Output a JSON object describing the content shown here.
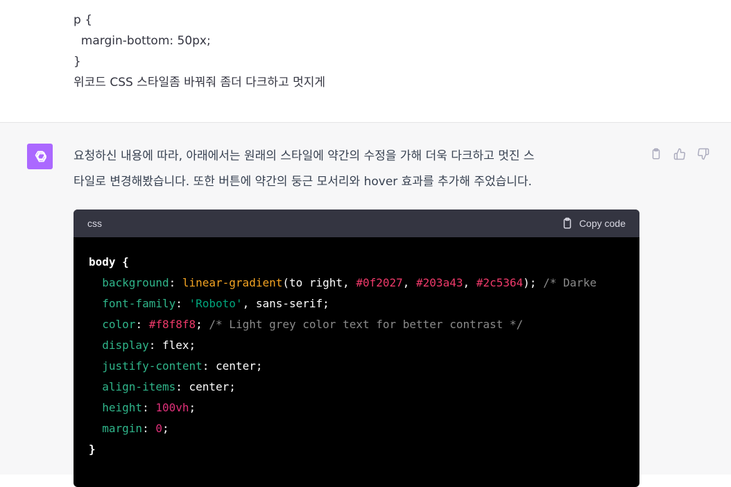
{
  "user_message": {
    "lines": [
      "p {",
      "  margin-bottom: 50px;",
      "}",
      "위코드 CSS 스타일좀 바꿔줘 좀더 다크하고 멋지게"
    ]
  },
  "assistant_message": {
    "lines": [
      "요청하신 내용에 따라, 아래에서는 원래의 스타일에 약간의 수정을 가해 더욱 다크하고 멋진 스",
      "타일로 변경해봤습니다. 또한 버튼에 약간의 둥근 모서리와 hover 효과를 추가해 주었습니다."
    ]
  },
  "code_block": {
    "language": "css",
    "copy_label": "Copy code",
    "selector": "body",
    "open_brace": " {",
    "close_brace": "}",
    "declarations": [
      {
        "prop": "background",
        "value_parts": [
          {
            "t": "fn",
            "v": "linear-gradient"
          },
          {
            "t": "plain",
            "v": "(to right, "
          },
          {
            "t": "hex",
            "v": "#0f2027"
          },
          {
            "t": "plain",
            "v": ", "
          },
          {
            "t": "hex",
            "v": "#203a43"
          },
          {
            "t": "plain",
            "v": ", "
          },
          {
            "t": "hex",
            "v": "#2c5364"
          },
          {
            "t": "plain",
            "v": "); "
          },
          {
            "t": "com",
            "v": "/* Darke"
          }
        ]
      },
      {
        "prop": "font-family",
        "value_parts": [
          {
            "t": "str",
            "v": "'Roboto'"
          },
          {
            "t": "plain",
            "v": ", sans-serif;"
          }
        ]
      },
      {
        "prop": "color",
        "value_parts": [
          {
            "t": "hex",
            "v": "#f8f8f8"
          },
          {
            "t": "plain",
            "v": "; "
          },
          {
            "t": "com",
            "v": "/* Light grey color text for better contrast */"
          }
        ]
      },
      {
        "prop": "display",
        "value_parts": [
          {
            "t": "plain",
            "v": "flex;"
          }
        ]
      },
      {
        "prop": "justify-content",
        "value_parts": [
          {
            "t": "plain",
            "v": "center;"
          }
        ]
      },
      {
        "prop": "align-items",
        "value_parts": [
          {
            "t": "plain",
            "v": "center;"
          }
        ]
      },
      {
        "prop": "height",
        "value_parts": [
          {
            "t": "num",
            "v": "100vh"
          },
          {
            "t": "plain",
            "v": ";"
          }
        ]
      },
      {
        "prop": "margin",
        "value_parts": [
          {
            "t": "num",
            "v": "0"
          },
          {
            "t": "plain",
            "v": ";"
          }
        ]
      }
    ]
  },
  "icons": {
    "avatar": "openai-logo-icon",
    "copy": "clipboard-icon",
    "thumbs_up": "thumbs-up-icon",
    "thumbs_down": "thumbs-down-icon"
  },
  "colors": {
    "avatar_bg": "#ab68ff",
    "code_header_bg": "#343541",
    "code_bg": "#000000",
    "assistant_bg": "#f7f7f8"
  }
}
